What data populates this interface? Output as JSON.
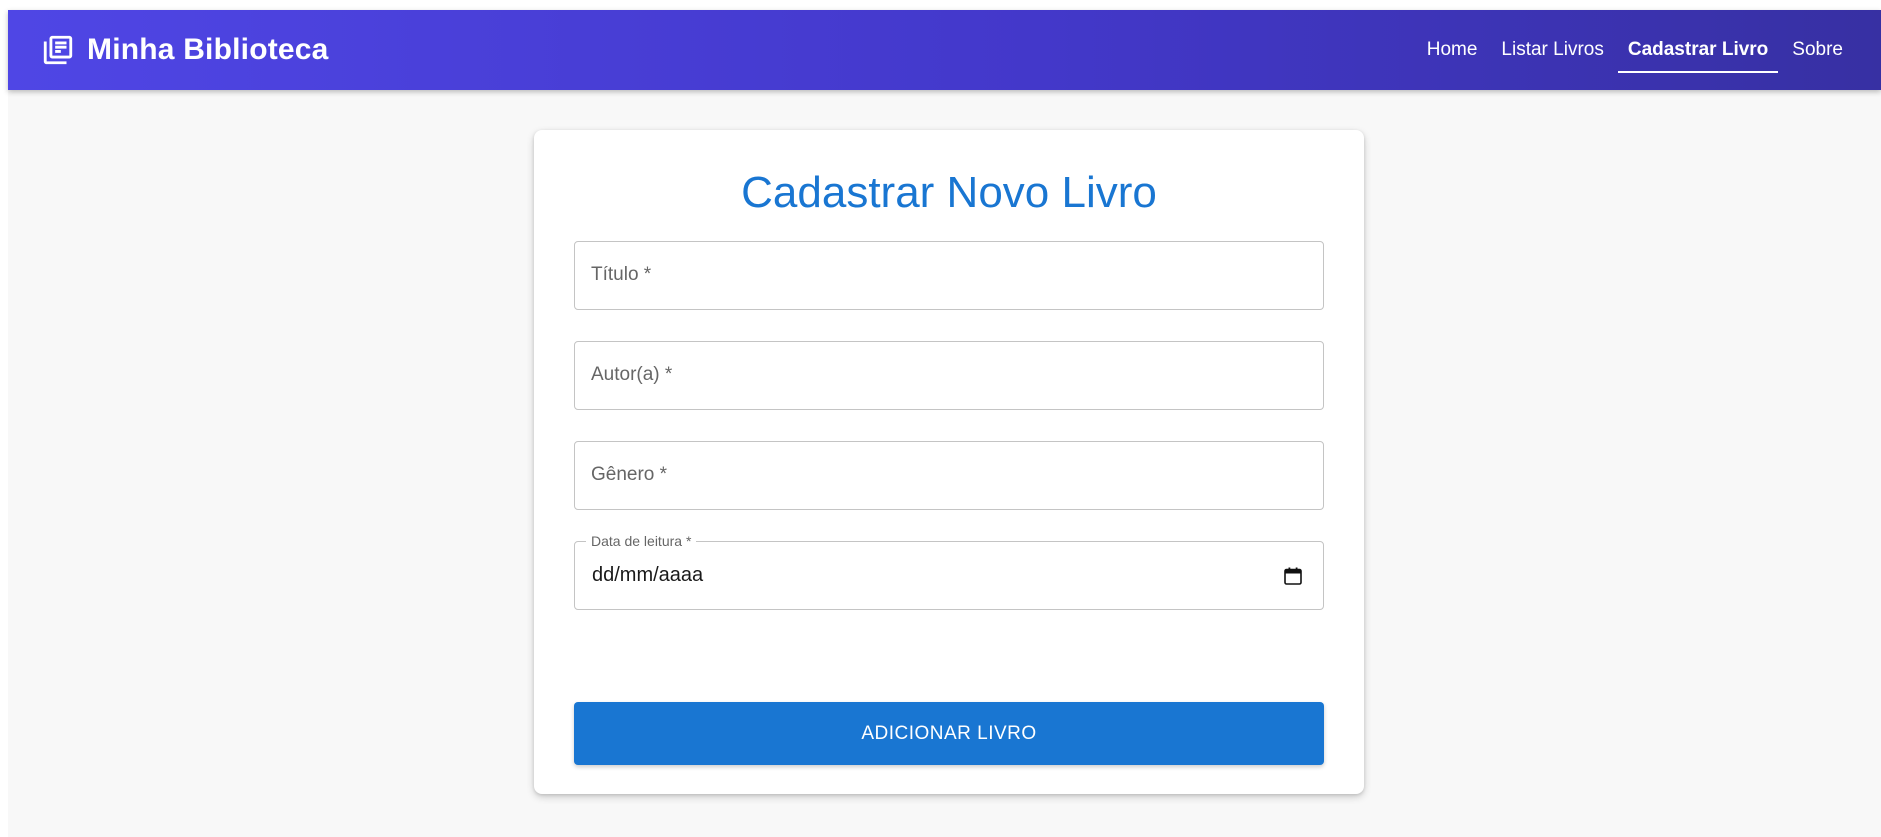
{
  "app": {
    "title": "Minha Biblioteca",
    "brand_icon": "library-books-icon"
  },
  "nav": {
    "items": [
      {
        "label": "Home",
        "active": false
      },
      {
        "label": "Listar Livros",
        "active": false
      },
      {
        "label": "Cadastrar Livro",
        "active": true
      },
      {
        "label": "Sobre",
        "active": false
      }
    ]
  },
  "form": {
    "title": "Cadastrar Novo Livro",
    "fields": {
      "titulo": {
        "label": "Título *",
        "value": ""
      },
      "autor": {
        "label": "Autor(a) *",
        "value": ""
      },
      "genero": {
        "label": "Gênero *",
        "value": ""
      },
      "data": {
        "label": "Data de leitura *",
        "placeholder": "dd/mm/aaaa",
        "icon": "calendar-icon"
      }
    },
    "submit_label": "ADICIONAR LIVRO"
  },
  "colors": {
    "appbar_start": "#4f46e5",
    "appbar_end": "#3730a3",
    "primary": "#1976d2",
    "background": "#f8f8f8"
  }
}
